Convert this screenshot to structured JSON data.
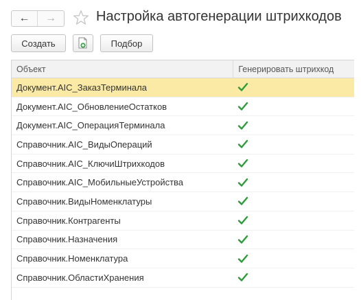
{
  "header": {
    "title": "Настройка автогенерации штрихкодов",
    "back_glyph": "←",
    "forward_glyph": "→"
  },
  "toolbar": {
    "create_label": "Создать",
    "pick_label": "Подбор"
  },
  "table": {
    "columns": [
      "Объект",
      "Генерировать штрихкод"
    ],
    "rows": [
      {
        "object": "Документ.AIC_ЗаказТерминала",
        "generate": true,
        "selected": true
      },
      {
        "object": "Документ.AIC_ОбновлениеОстатков",
        "generate": true
      },
      {
        "object": "Документ.AIC_ОперацияТерминала",
        "generate": true
      },
      {
        "object": "Справочник.AIC_ВидыОпераций",
        "generate": true
      },
      {
        "object": "Справочник.AIC_КлючиШтрихкодов",
        "generate": true
      },
      {
        "object": "Справочник.AIC_МобильныеУстройства",
        "generate": true
      },
      {
        "object": "Справочник.ВидыНоменклатуры",
        "generate": true
      },
      {
        "object": "Справочник.Контрагенты",
        "generate": true
      },
      {
        "object": "Справочник.Назначения",
        "generate": true
      },
      {
        "object": "Справочник.Номенклатура",
        "generate": true
      },
      {
        "object": "Справочник.ОбластиХранения",
        "generate": true
      }
    ]
  },
  "colors": {
    "selected_row": "#faeaa5",
    "check": "#2e9b3a",
    "star_outline": "#c8c8c8"
  },
  "icons": {
    "back": "arrow-left-icon",
    "forward": "arrow-right-icon",
    "favorite": "star-outline-icon",
    "copy": "copy-document-icon",
    "check": "checkmark-icon"
  }
}
